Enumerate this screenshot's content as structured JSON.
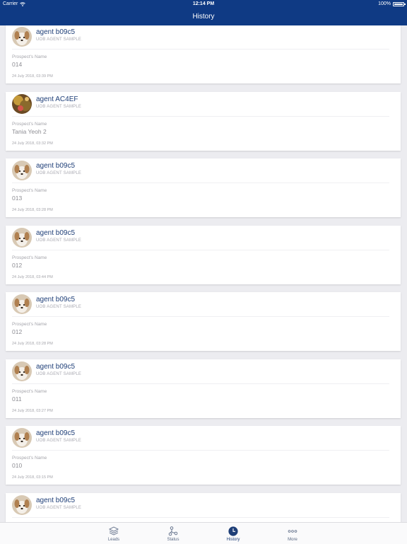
{
  "status_bar": {
    "carrier": "Carrier",
    "time": "12:14 PM",
    "battery": "100%"
  },
  "nav": {
    "title": "History"
  },
  "history": [
    {
      "agent": "agent b09c5",
      "role": "UOB AGENT SAMPLE",
      "label": "Prospect's Name",
      "value": "014",
      "time": "24 July 2018, 03:39 PM",
      "avatar": "dog"
    },
    {
      "agent": "agent AC4EF",
      "role": "UOB AGENT SAMPLE",
      "label": "Prospect's Name",
      "value": "Tania Yeoh 2",
      "time": "24 July 2018, 03:32 PM",
      "avatar": "photo"
    },
    {
      "agent": "agent b09c5",
      "role": "UOB AGENT SAMPLE",
      "label": "Prospect's Name",
      "value": "013",
      "time": "24 July 2018, 03:28 PM",
      "avatar": "dog"
    },
    {
      "agent": "agent b09c5",
      "role": "UOB AGENT SAMPLE",
      "label": "Prospect's Name",
      "value": "012",
      "time": "24 July 2018, 03:44 PM",
      "avatar": "dog"
    },
    {
      "agent": "agent b09c5",
      "role": "UOB AGENT SAMPLE",
      "label": "Prospect's Name",
      "value": "012",
      "time": "24 July 2018, 03:28 PM",
      "avatar": "dog"
    },
    {
      "agent": "agent b09c5",
      "role": "UOB AGENT SAMPLE",
      "label": "Prospect's Name",
      "value": "011",
      "time": "24 July 2018, 03:27 PM",
      "avatar": "dog"
    },
    {
      "agent": "agent b09c5",
      "role": "UOB AGENT SAMPLE",
      "label": "Prospect's Name",
      "value": "010",
      "time": "24 July 2018, 03:15 PM",
      "avatar": "dog"
    },
    {
      "agent": "agent b09c5",
      "role": "UOB AGENT SAMPLE",
      "label": "",
      "value": "",
      "time": "",
      "avatar": "dog"
    }
  ],
  "tabs": [
    {
      "label": "Leads",
      "icon": "layers-icon",
      "active": false
    },
    {
      "label": "Status",
      "icon": "status-flow-icon",
      "active": false
    },
    {
      "label": "History",
      "icon": "clock-icon",
      "active": true
    },
    {
      "label": "More",
      "icon": "more-dots-icon",
      "active": false
    }
  ],
  "colors": {
    "brand": "#0f3a84",
    "agent_name": "#1f3f78",
    "background": "#ececf0"
  }
}
